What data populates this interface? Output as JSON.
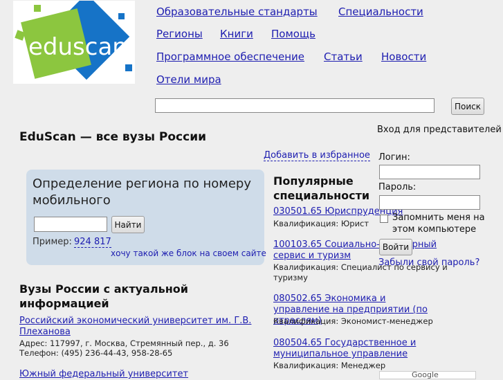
{
  "logo": {
    "text": "eduscan"
  },
  "nav": {
    "items": [
      "Образовательные стандарты",
      "Специальности",
      "Регионы",
      "Книги",
      "Помощь",
      "Программное обеспечение",
      "Статьи",
      "Новости",
      "Отели мира"
    ]
  },
  "search": {
    "button_label": "Поиск",
    "value": ""
  },
  "site_title": "EduScan — все вузы России",
  "favorites_link": "Добавить в избранное",
  "region_widget": {
    "title": "Определение региона по номеру мобильного",
    "button_label": "Найти",
    "example_label": "Пример:",
    "example_number": "924 817",
    "widget_link": "хочу такой же блок на своем сайте"
  },
  "universities": {
    "heading": "Вузы России с актуальной информацией",
    "items": [
      {
        "name": "Российский экономический университет им. Г.В. Плеханова",
        "address": "Адрес: 117997, г. Москва, Стремянный пер., д. 36",
        "phone": "Телефон: (495) 236-44-43, 958-28-65"
      },
      {
        "name": "Южный федеральный университет"
      }
    ]
  },
  "specialties": {
    "heading": "Популярные специальности",
    "items": [
      {
        "name": "030501.65 Юриспруденция",
        "qualification": "Квалификация: Юрист"
      },
      {
        "name": "100103.65 Социально-культурный сервис и туризм",
        "qualification": "Квалификация: Специалист по сервису и туризму"
      },
      {
        "name": "080502.65 Экономика и управление на предприятии (по отраслям)",
        "qualification": "Квалификация: Экономист-менеджер"
      },
      {
        "name": "080504.65 Государственное и муниципальное управление",
        "qualification": "Квалификация: Менеджер"
      }
    ]
  },
  "login": {
    "heading": "Вход для представителей",
    "login_label": "Логин:",
    "password_label": "Пароль:",
    "remember_label": "Запомнить меня на этом компьютере",
    "submit_label": "Войти",
    "forgot_link": "Забыли свой пароль?"
  },
  "google_badge": {
    "text": "Google"
  }
}
